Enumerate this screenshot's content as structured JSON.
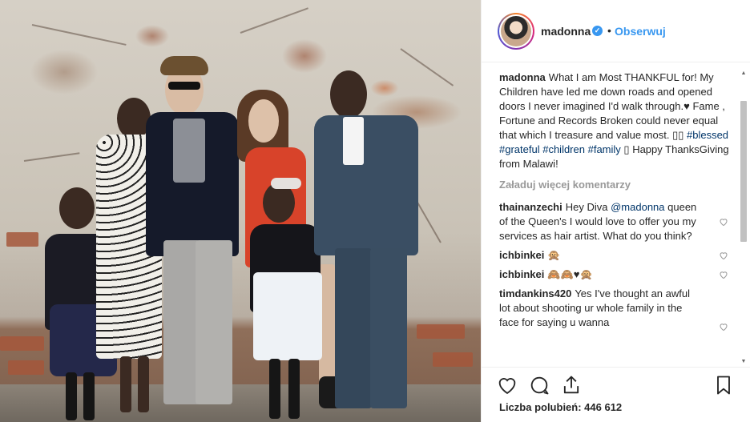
{
  "post": {
    "username": "madonna",
    "verified_glyph": "✓",
    "separator": "•",
    "follow_label": "Obserwuj",
    "caption_user": "madonna",
    "caption_text_1": "What I am Most THANKFUL for! My Children have led me down roads and opened doors I never imagined I'd walk through.♥ Fame , Fortune and Records Broken could never equal that which I treasure and value most. ",
    "caption_emoji": "▯▯",
    "caption_tag_blessed": "#blessed",
    "caption_tag_grateful": "#grateful",
    "caption_tag_children": "#children",
    "caption_tag_family": "#family",
    "caption_glyph": "▯",
    "caption_text_2": " Happy ThanksGiving from Malawi!",
    "load_more": "Załaduj więcej komentarzy",
    "likes": "Liczba polubień: 446 612"
  },
  "comments": [
    {
      "user": "thainanzechi",
      "pre": "Hey Diva ",
      "mention": "@madonna",
      "post": " queen of the Queen's I would love to offer you my services as hair artist. What do you think?"
    },
    {
      "user": "ichbinkei",
      "text": "🙊"
    },
    {
      "user": "ichbinkei",
      "text": "🙈🙈♥🙊"
    },
    {
      "user": "timdankins420",
      "text": "Yes I've thought an awful lot about shooting ur whole family in the face for saying u wanna"
    }
  ],
  "icons": {
    "like": "heart-icon",
    "comment": "comment-icon",
    "share": "share-icon",
    "save": "bookmark-icon",
    "comment_like": "heart-outline-icon",
    "scroll_up": "▲",
    "scroll_down": "▼"
  },
  "colors": {
    "link": "#3897f0",
    "hashtag": "#003569",
    "muted": "#999999",
    "text": "#262626"
  }
}
